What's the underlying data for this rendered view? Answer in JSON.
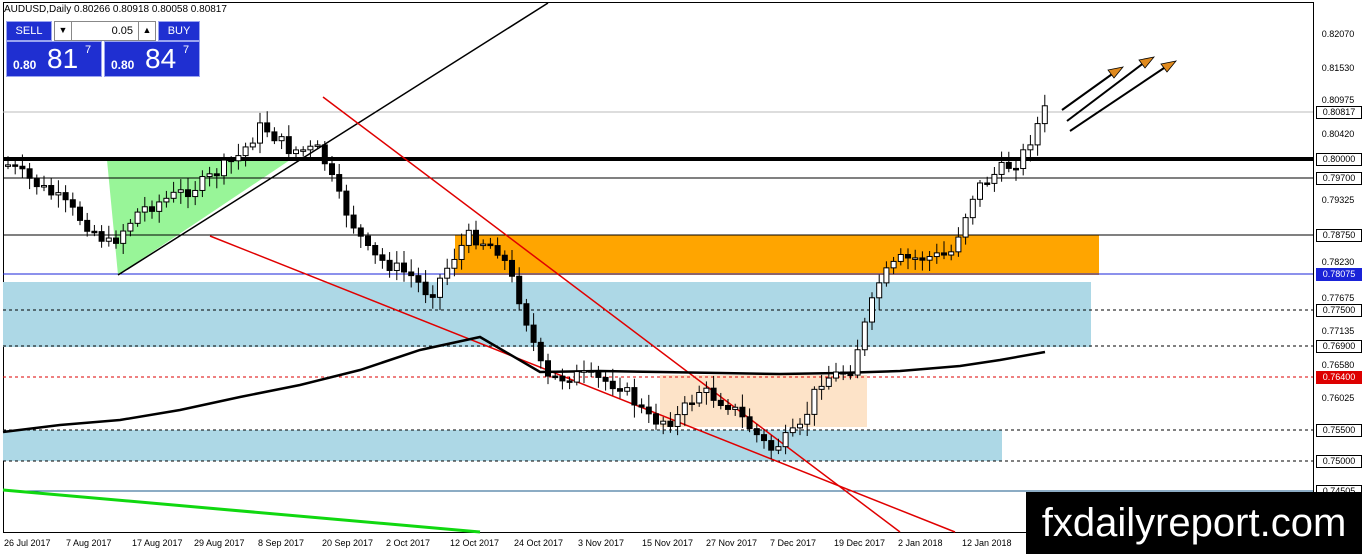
{
  "chart": {
    "title": "AUDUSD,Daily  0.80266 0.80918 0.80058 0.80817",
    "price_ticks": [
      "0.82070",
      "0.81530",
      "0.80975",
      "0.80420",
      "0.79325",
      "0.78230",
      "0.77675",
      "0.77135",
      "0.76580",
      "0.76025"
    ],
    "date_ticks": [
      "26 Jul 2017",
      "7 Aug 2017",
      "17 Aug 2017",
      "29 Aug 2017",
      "8 Sep 2017",
      "20 Sep 2017",
      "2 Oct 2017",
      "12 Oct 2017",
      "24 Oct 2017",
      "3 Nov 2017",
      "15 Nov 2017",
      "27 Nov 2017",
      "7 Dec 2017",
      "19 Dec 2017",
      "2 Jan 2018",
      "12 Jan 2018"
    ]
  },
  "levels": {
    "current": "0.80817",
    "l_80000": "0.80000",
    "l_79700": "0.79700",
    "l_78750": "0.78750",
    "l_78075": "0.78075",
    "l_77500": "0.77500",
    "l_76900": "0.76900",
    "l_76400": "0.76400",
    "l_75500": "0.75500",
    "l_75000": "0.75000",
    "l_74505": "0.74505"
  },
  "trade_panel": {
    "sell_label": "SELL",
    "buy_label": "BUY",
    "lot_value": "0.05",
    "lot_down_icon": "▼",
    "lot_up_icon": "▲",
    "sell_prefix": "0.80",
    "sell_big": "81",
    "sell_sup": "7",
    "buy_prefix": "0.80",
    "buy_big": "84",
    "buy_sup": "7"
  },
  "watermark": "fxdailyreport.com",
  "colors": {
    "zone_orange": "#ffa500",
    "zone_peach": "#fde3c8",
    "zone_blue": "#add8e6",
    "triangle_green": "#98f598",
    "trend_red": "#e00000",
    "ma_black": "#000000",
    "arrow_orange": "#e08a1e"
  }
}
